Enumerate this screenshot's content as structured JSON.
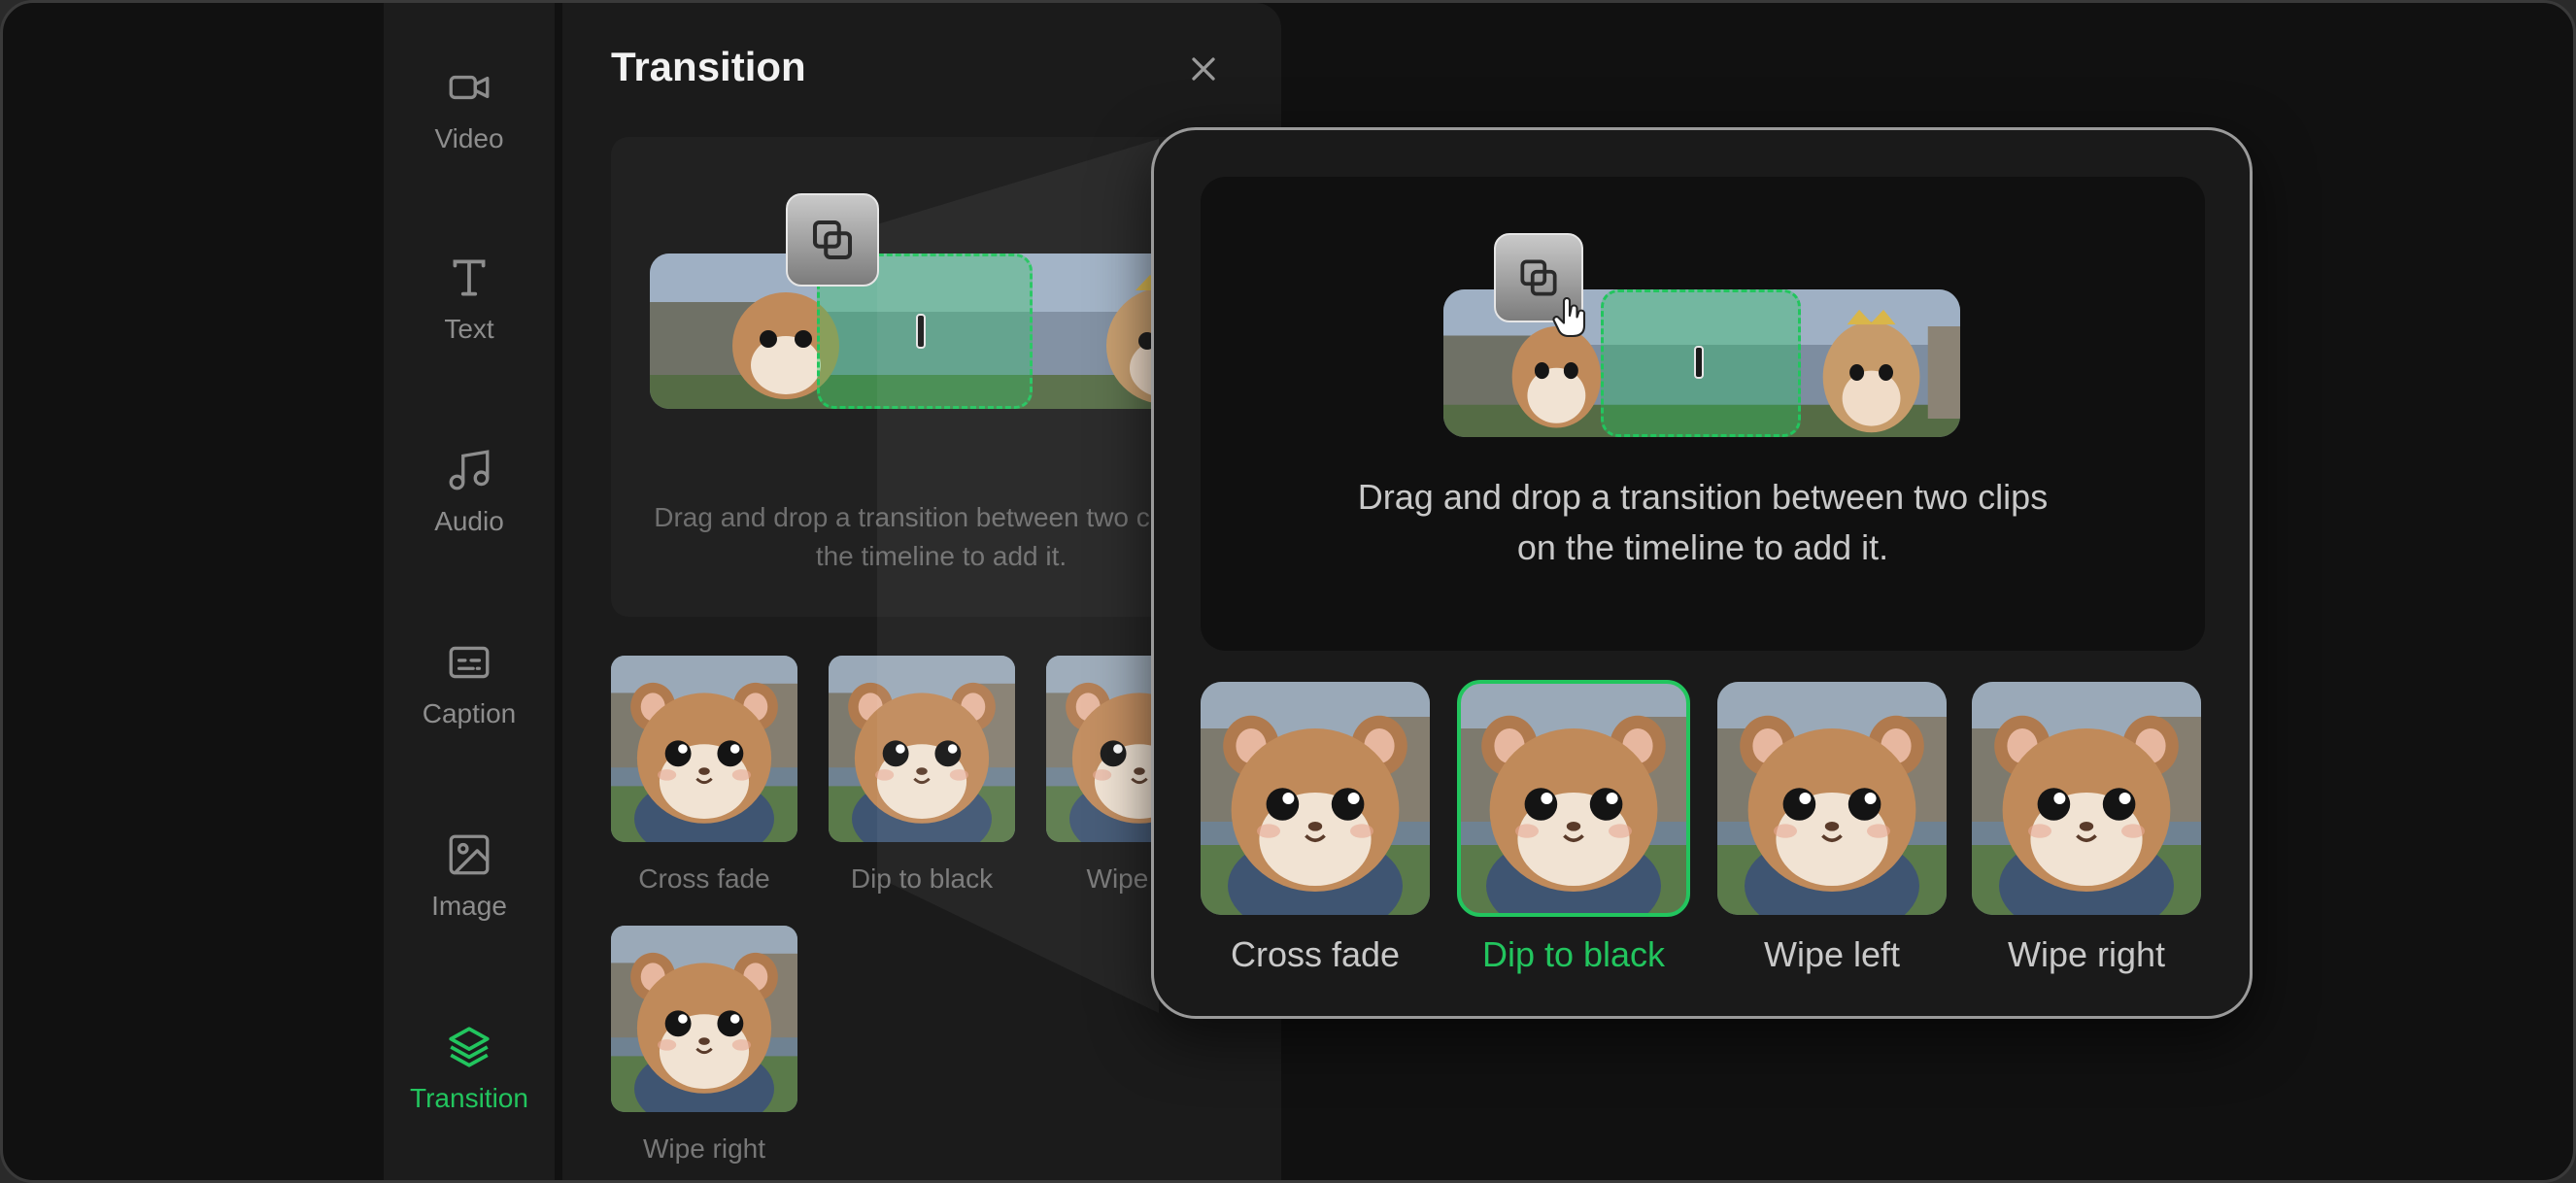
{
  "colors": {
    "accent": "#22c55e",
    "background": "#111111",
    "panel": "#1b1b1b",
    "text_muted": "#8d8d8d"
  },
  "nav": {
    "items": [
      {
        "label": "Video",
        "icon": "video-camera-icon",
        "active": false
      },
      {
        "label": "Text",
        "icon": "text-t-icon",
        "active": false
      },
      {
        "label": "Audio",
        "icon": "music-note-icon",
        "active": false
      },
      {
        "label": "Caption",
        "icon": "caption-icon",
        "active": false
      },
      {
        "label": "Image",
        "icon": "image-icon",
        "active": false
      },
      {
        "label": "Transition",
        "icon": "layers-icon",
        "active": true
      }
    ]
  },
  "panel": {
    "title": "Transition",
    "close_icon": "close-icon",
    "hint": "Drag and drop a transition between two clips on the timeline to add it.",
    "thumbnails": [
      {
        "label": "Cross fade"
      },
      {
        "label": "Dip to black"
      },
      {
        "label": "Wipe left"
      },
      {
        "label": "Wipe right"
      }
    ]
  },
  "zoom": {
    "hint_line1": "Drag and drop a transition between two clips",
    "hint_line2": "on the timeline to add it.",
    "drag_icon": "transition-copy-icon",
    "cursor_icon": "hand-cursor-icon",
    "tiles": [
      {
        "label": "Cross fade",
        "selected": false
      },
      {
        "label": "Dip to black",
        "selected": true
      },
      {
        "label": "Wipe left",
        "selected": false
      },
      {
        "label": "Wipe right",
        "selected": false
      }
    ]
  }
}
